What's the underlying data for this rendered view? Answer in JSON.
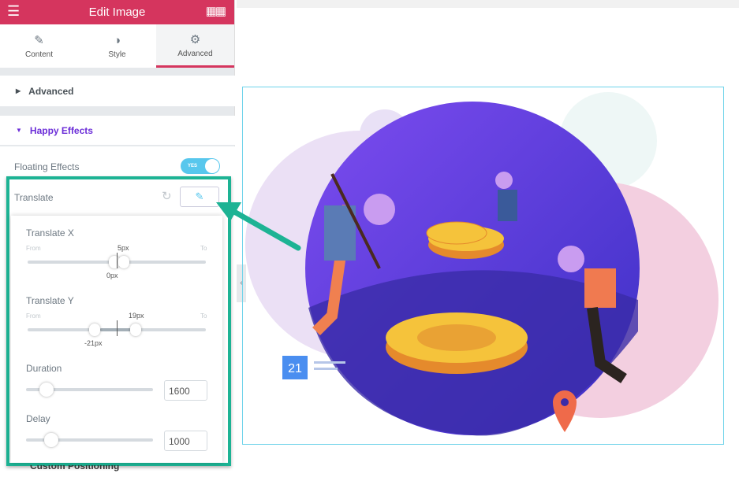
{
  "header": {
    "title": "Edit Image",
    "menu_icon": "hamburger-icon",
    "apps_icon": "grid-icon"
  },
  "tabs": [
    {
      "label": "Content",
      "icon": "pencil-icon"
    },
    {
      "label": "Style",
      "icon": "contrast-icon"
    },
    {
      "label": "Advanced",
      "icon": "gear-icon",
      "active": true
    }
  ],
  "sections": {
    "advanced": "Advanced",
    "happy_effects": "Happy Effects",
    "custom_positioning": "Custom Positioning"
  },
  "floating": {
    "label": "Floating Effects",
    "toggle": "YES",
    "enabled": true
  },
  "translate": {
    "label": "Translate"
  },
  "popup": {
    "translate_x": {
      "label": "Translate X",
      "from": "From",
      "to": "To",
      "upper": "5px",
      "lower": "0px"
    },
    "translate_y": {
      "label": "Translate Y",
      "from": "From",
      "to": "To",
      "upper": "19px",
      "lower": "-21px"
    },
    "duration": {
      "label": "Duration",
      "value": "1600"
    },
    "delay": {
      "label": "Delay",
      "value": "1000"
    }
  },
  "illustration": {
    "calendar_day": "21"
  },
  "colors": {
    "brand": "#d5355e",
    "accent": "#6c2ed8",
    "highlight": "#1db394",
    "toggle": "#58c7ed"
  }
}
